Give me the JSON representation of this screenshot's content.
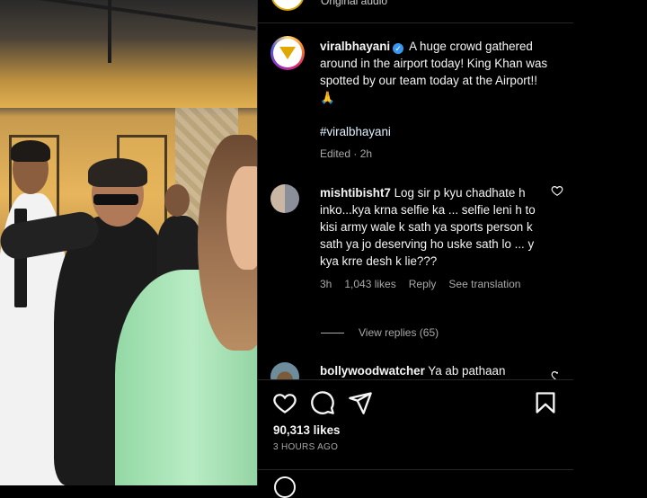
{
  "post": {
    "top_audio": "Original audio",
    "author": "viralbhayani",
    "verified_mark": "✓",
    "caption": "A huge crowd gathered around in the airport today! King Khan was spotted by our team today at the Airport!! 🙏",
    "hashtag": "#viralbhayani",
    "meta": "Edited · 2h"
  },
  "comments": [
    {
      "username": "mishtibisht7",
      "text": "Log sir p kyu chadhate h inko...kya krna selfie ka ... selfie leni h to kisi army wale k sath ya sports person k sath ya jo deserving ho uske sath lo ... y kya krre desh k lie???",
      "time": "3h",
      "likes": "1,043 likes",
      "reply": "Reply",
      "translate": "See translation",
      "view_replies": "View replies (65)"
    },
    {
      "username": "bollywoodwatcher",
      "text": "Ya ab pathaan"
    }
  ],
  "stats": {
    "likes": "90,313 likes",
    "time": "3 HOURS AGO"
  },
  "icons": {
    "like": "heart-icon",
    "comment": "comment-icon",
    "share": "send-icon",
    "save": "bookmark-icon"
  },
  "colors": {
    "background": "#000000",
    "text": "#f5f5f5",
    "muted": "#a8a8a8",
    "verified": "#3897f0",
    "brand": "#e0a800"
  }
}
